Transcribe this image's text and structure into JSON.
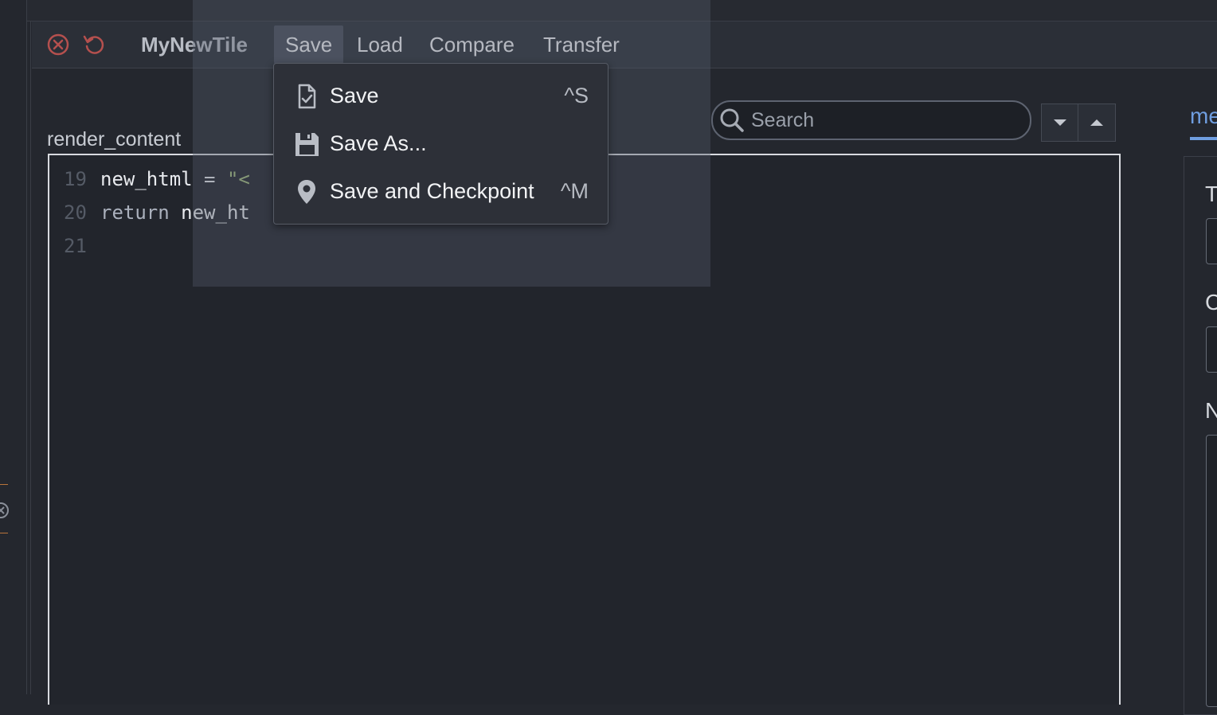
{
  "header": {
    "close_icon": "close-circle-icon",
    "reload_icon": "reload-icon",
    "title": "MyNewTile",
    "menu": [
      "Save",
      "Load",
      "Compare",
      "Transfer"
    ],
    "active_menu": "Save"
  },
  "save_dropdown": {
    "items": [
      {
        "label": "Save",
        "shortcut": "^S",
        "icon": "save-file-icon"
      },
      {
        "label": "Save As...",
        "shortcut": "",
        "icon": "floppy-disk-icon"
      },
      {
        "label": "Save and Checkpoint",
        "shortcut": "^M",
        "icon": "map-pin-icon"
      }
    ]
  },
  "editor": {
    "section_label": "render_content",
    "lines": [
      {
        "num": "19",
        "parts": [
          {
            "t": "new_html",
            "c": "var"
          },
          {
            "t": " = ",
            "c": "var"
          },
          {
            "t": "\"<",
            "c": "str"
          }
        ]
      },
      {
        "num": "20",
        "parts": [
          {
            "t": "return",
            "c": "kw"
          },
          {
            "t": " new_ht",
            "c": "var"
          }
        ]
      },
      {
        "num": "21",
        "parts": []
      }
    ]
  },
  "search": {
    "placeholder": "Search"
  },
  "right_panel": {
    "tab_label": "me",
    "labels": [
      "T",
      "C",
      "N"
    ]
  },
  "colors": {
    "accent": "#6f9ee0",
    "close_icon": "#b5504e",
    "string": "#a7c080"
  }
}
